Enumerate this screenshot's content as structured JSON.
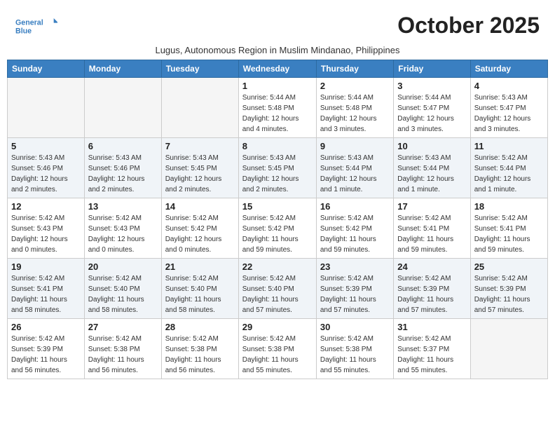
{
  "header": {
    "logo_line1": "General",
    "logo_line2": "Blue",
    "month": "October 2025",
    "subtitle": "Lugus, Autonomous Region in Muslim Mindanao, Philippines"
  },
  "weekdays": [
    "Sunday",
    "Monday",
    "Tuesday",
    "Wednesday",
    "Thursday",
    "Friday",
    "Saturday"
  ],
  "weeks": [
    [
      {
        "day": "",
        "info": ""
      },
      {
        "day": "",
        "info": ""
      },
      {
        "day": "",
        "info": ""
      },
      {
        "day": "1",
        "info": "Sunrise: 5:44 AM\nSunset: 5:48 PM\nDaylight: 12 hours\nand 4 minutes."
      },
      {
        "day": "2",
        "info": "Sunrise: 5:44 AM\nSunset: 5:48 PM\nDaylight: 12 hours\nand 3 minutes."
      },
      {
        "day": "3",
        "info": "Sunrise: 5:44 AM\nSunset: 5:47 PM\nDaylight: 12 hours\nand 3 minutes."
      },
      {
        "day": "4",
        "info": "Sunrise: 5:43 AM\nSunset: 5:47 PM\nDaylight: 12 hours\nand 3 minutes."
      }
    ],
    [
      {
        "day": "5",
        "info": "Sunrise: 5:43 AM\nSunset: 5:46 PM\nDaylight: 12 hours\nand 2 minutes."
      },
      {
        "day": "6",
        "info": "Sunrise: 5:43 AM\nSunset: 5:46 PM\nDaylight: 12 hours\nand 2 minutes."
      },
      {
        "day": "7",
        "info": "Sunrise: 5:43 AM\nSunset: 5:45 PM\nDaylight: 12 hours\nand 2 minutes."
      },
      {
        "day": "8",
        "info": "Sunrise: 5:43 AM\nSunset: 5:45 PM\nDaylight: 12 hours\nand 2 minutes."
      },
      {
        "day": "9",
        "info": "Sunrise: 5:43 AM\nSunset: 5:44 PM\nDaylight: 12 hours\nand 1 minute."
      },
      {
        "day": "10",
        "info": "Sunrise: 5:43 AM\nSunset: 5:44 PM\nDaylight: 12 hours\nand 1 minute."
      },
      {
        "day": "11",
        "info": "Sunrise: 5:42 AM\nSunset: 5:44 PM\nDaylight: 12 hours\nand 1 minute."
      }
    ],
    [
      {
        "day": "12",
        "info": "Sunrise: 5:42 AM\nSunset: 5:43 PM\nDaylight: 12 hours\nand 0 minutes."
      },
      {
        "day": "13",
        "info": "Sunrise: 5:42 AM\nSunset: 5:43 PM\nDaylight: 12 hours\nand 0 minutes."
      },
      {
        "day": "14",
        "info": "Sunrise: 5:42 AM\nSunset: 5:42 PM\nDaylight: 12 hours\nand 0 minutes."
      },
      {
        "day": "15",
        "info": "Sunrise: 5:42 AM\nSunset: 5:42 PM\nDaylight: 11 hours\nand 59 minutes."
      },
      {
        "day": "16",
        "info": "Sunrise: 5:42 AM\nSunset: 5:42 PM\nDaylight: 11 hours\nand 59 minutes."
      },
      {
        "day": "17",
        "info": "Sunrise: 5:42 AM\nSunset: 5:41 PM\nDaylight: 11 hours\nand 59 minutes."
      },
      {
        "day": "18",
        "info": "Sunrise: 5:42 AM\nSunset: 5:41 PM\nDaylight: 11 hours\nand 59 minutes."
      }
    ],
    [
      {
        "day": "19",
        "info": "Sunrise: 5:42 AM\nSunset: 5:41 PM\nDaylight: 11 hours\nand 58 minutes."
      },
      {
        "day": "20",
        "info": "Sunrise: 5:42 AM\nSunset: 5:40 PM\nDaylight: 11 hours\nand 58 minutes."
      },
      {
        "day": "21",
        "info": "Sunrise: 5:42 AM\nSunset: 5:40 PM\nDaylight: 11 hours\nand 58 minutes."
      },
      {
        "day": "22",
        "info": "Sunrise: 5:42 AM\nSunset: 5:40 PM\nDaylight: 11 hours\nand 57 minutes."
      },
      {
        "day": "23",
        "info": "Sunrise: 5:42 AM\nSunset: 5:39 PM\nDaylight: 11 hours\nand 57 minutes."
      },
      {
        "day": "24",
        "info": "Sunrise: 5:42 AM\nSunset: 5:39 PM\nDaylight: 11 hours\nand 57 minutes."
      },
      {
        "day": "25",
        "info": "Sunrise: 5:42 AM\nSunset: 5:39 PM\nDaylight: 11 hours\nand 57 minutes."
      }
    ],
    [
      {
        "day": "26",
        "info": "Sunrise: 5:42 AM\nSunset: 5:39 PM\nDaylight: 11 hours\nand 56 minutes."
      },
      {
        "day": "27",
        "info": "Sunrise: 5:42 AM\nSunset: 5:38 PM\nDaylight: 11 hours\nand 56 minutes."
      },
      {
        "day": "28",
        "info": "Sunrise: 5:42 AM\nSunset: 5:38 PM\nDaylight: 11 hours\nand 56 minutes."
      },
      {
        "day": "29",
        "info": "Sunrise: 5:42 AM\nSunset: 5:38 PM\nDaylight: 11 hours\nand 55 minutes."
      },
      {
        "day": "30",
        "info": "Sunrise: 5:42 AM\nSunset: 5:38 PM\nDaylight: 11 hours\nand 55 minutes."
      },
      {
        "day": "31",
        "info": "Sunrise: 5:42 AM\nSunset: 5:37 PM\nDaylight: 11 hours\nand 55 minutes."
      },
      {
        "day": "",
        "info": ""
      }
    ]
  ]
}
